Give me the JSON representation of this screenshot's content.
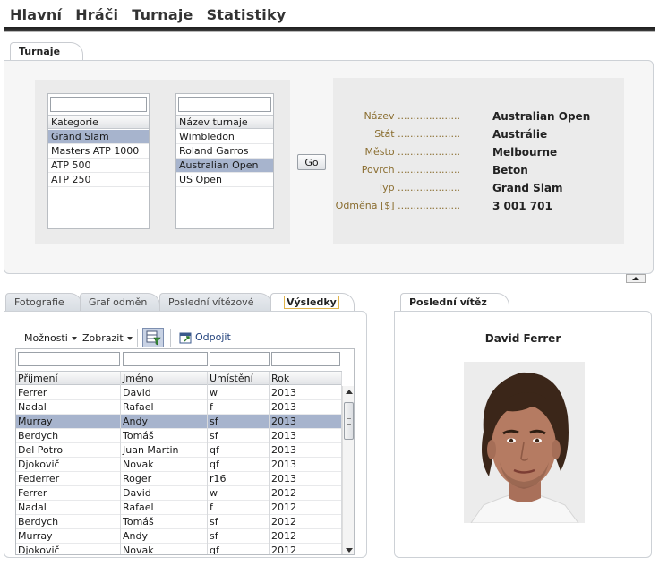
{
  "nav": {
    "items": [
      "Hlavní",
      "Hráči",
      "Turnaje",
      "Statistiky"
    ]
  },
  "tournaments_tab": {
    "label": "Turnaje"
  },
  "category_list": {
    "filter_value": "",
    "header": "Kategorie",
    "items": [
      "Grand Slam",
      "Masters ATP 1000",
      "ATP 500",
      "ATP 250"
    ],
    "selected_index": 0
  },
  "tournament_list": {
    "filter_value": "",
    "header": "Název turnaje",
    "items": [
      "Wimbledon",
      "Roland Garros",
      "Australian Open",
      "US Open"
    ],
    "selected_index": 2
  },
  "go_button": {
    "label": "Go"
  },
  "detail": {
    "rows": [
      {
        "label": "Název ....................",
        "value": "Australian Open"
      },
      {
        "label": "Stát ....................",
        "value": "Austrálie"
      },
      {
        "label": "Město ....................",
        "value": "Melbourne"
      },
      {
        "label": "Povrch ....................",
        "value": "Beton"
      },
      {
        "label": "Typ ....................",
        "value": "Grand Slam"
      },
      {
        "label": "Odměna [$] ....................",
        "value": "3 001 701"
      }
    ]
  },
  "results_tabs": {
    "items": [
      {
        "label": "Fotografie",
        "active": false
      },
      {
        "label": "Graf odměn",
        "active": false
      },
      {
        "label": "Poslední vítězové",
        "active": false
      },
      {
        "label": "Výsledky",
        "active": true
      }
    ]
  },
  "toolbar": {
    "options_label": "Možnosti",
    "view_label": "Zobrazit",
    "detach_label": "Odpojit",
    "icons": [
      "filter-grid-icon",
      "detach-icon"
    ]
  },
  "results_table": {
    "columns": [
      "Příjmení",
      "Jméno",
      "Umístění",
      "Rok"
    ],
    "selected_index": 2,
    "rows": [
      [
        "Ferrer",
        "David",
        "w",
        "2013"
      ],
      [
        "Nadal",
        "Rafael",
        "f",
        "2013"
      ],
      [
        "Murray",
        "Andy",
        "sf",
        "2013"
      ],
      [
        "Berdych",
        "Tomáš",
        "sf",
        "2013"
      ],
      [
        "Del Potro",
        "Juan Martin",
        "qf",
        "2013"
      ],
      [
        "Djokovič",
        "Novak",
        "qf",
        "2013"
      ],
      [
        "Federrer",
        "Roger",
        "r16",
        "2013"
      ],
      [
        "Ferrer",
        "David",
        "w",
        "2012"
      ],
      [
        "Nadal",
        "Rafael",
        "f",
        "2012"
      ],
      [
        "Berdych",
        "Tomáš",
        "sf",
        "2012"
      ],
      [
        "Murray",
        "Andy",
        "sf",
        "2012"
      ],
      [
        "Djokovič",
        "Novak",
        "qf",
        "2012"
      ]
    ]
  },
  "winner_tab": {
    "label": "Poslední vítěz"
  },
  "winner": {
    "name": "David Ferrer"
  },
  "colors": {
    "selection": "#a7b4cd",
    "label_gold": "#8a6d2f",
    "nav_bar": "#1d1d1d"
  }
}
